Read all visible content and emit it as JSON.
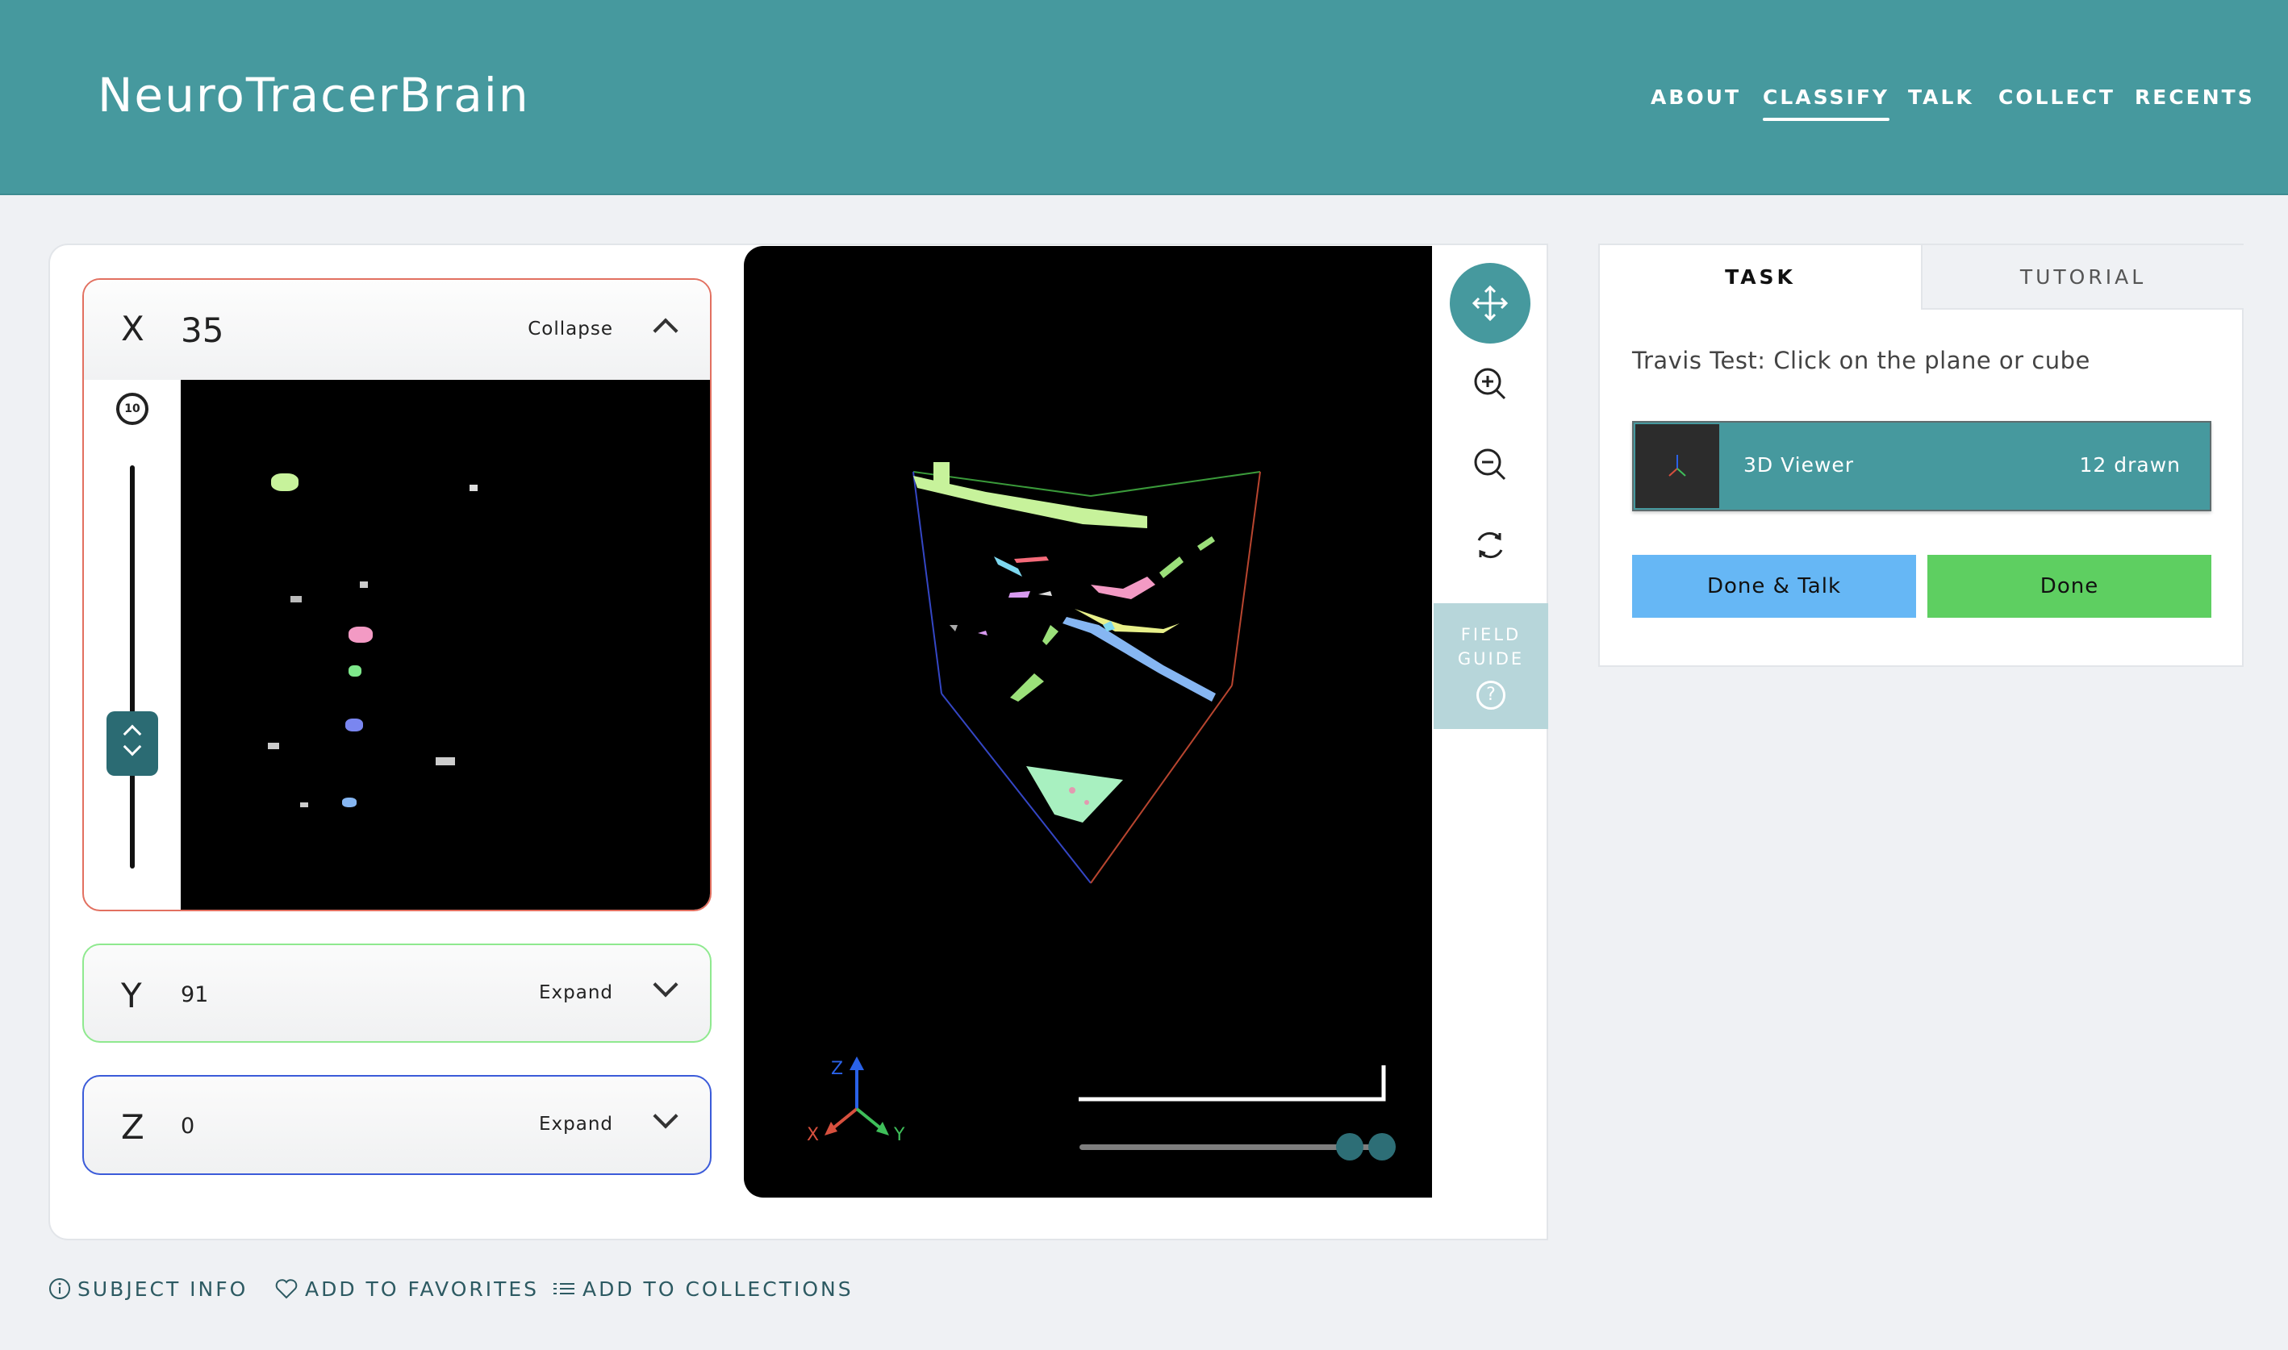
{
  "header": {
    "brand": "NeuroTracerBrain",
    "nav": [
      "ABOUT",
      "CLASSIFY",
      "TALK",
      "COLLECT",
      "RECENTS"
    ],
    "active_nav": "CLASSIFY"
  },
  "planes": {
    "x": {
      "letter": "X",
      "value": "35",
      "toggle": "Collapse",
      "color": "#e27060"
    },
    "y": {
      "letter": "Y",
      "value": "91",
      "toggle": "Expand",
      "color": "#8fe98f"
    },
    "z": {
      "letter": "Z",
      "value": "0",
      "toggle": "Expand",
      "color": "#3b5bd9"
    }
  },
  "replay_label": "10",
  "axes_gizmo": {
    "x": "X",
    "y": "Y",
    "z": "Z"
  },
  "toolbar": {
    "field_guide_line1": "FIELD",
    "field_guide_line2": "GUIDE",
    "field_guide_icon": "?"
  },
  "task": {
    "tab_task": "TASK",
    "tab_tutorial": "TUTORIAL",
    "instruction": "Travis Test: Click on the plane or cube",
    "tool_name": "3D Viewer",
    "tool_count": "12 drawn",
    "done_talk": "Done & Talk",
    "done": "Done"
  },
  "footer": {
    "subject_info": "SUBJECT INFO",
    "favorites": "ADD TO FAVORITES",
    "collections": "ADD TO COLLECTIONS"
  },
  "colors": {
    "brand_teal": "#46999e",
    "done_talk": "#66b7f5",
    "done": "#5ecf61"
  }
}
